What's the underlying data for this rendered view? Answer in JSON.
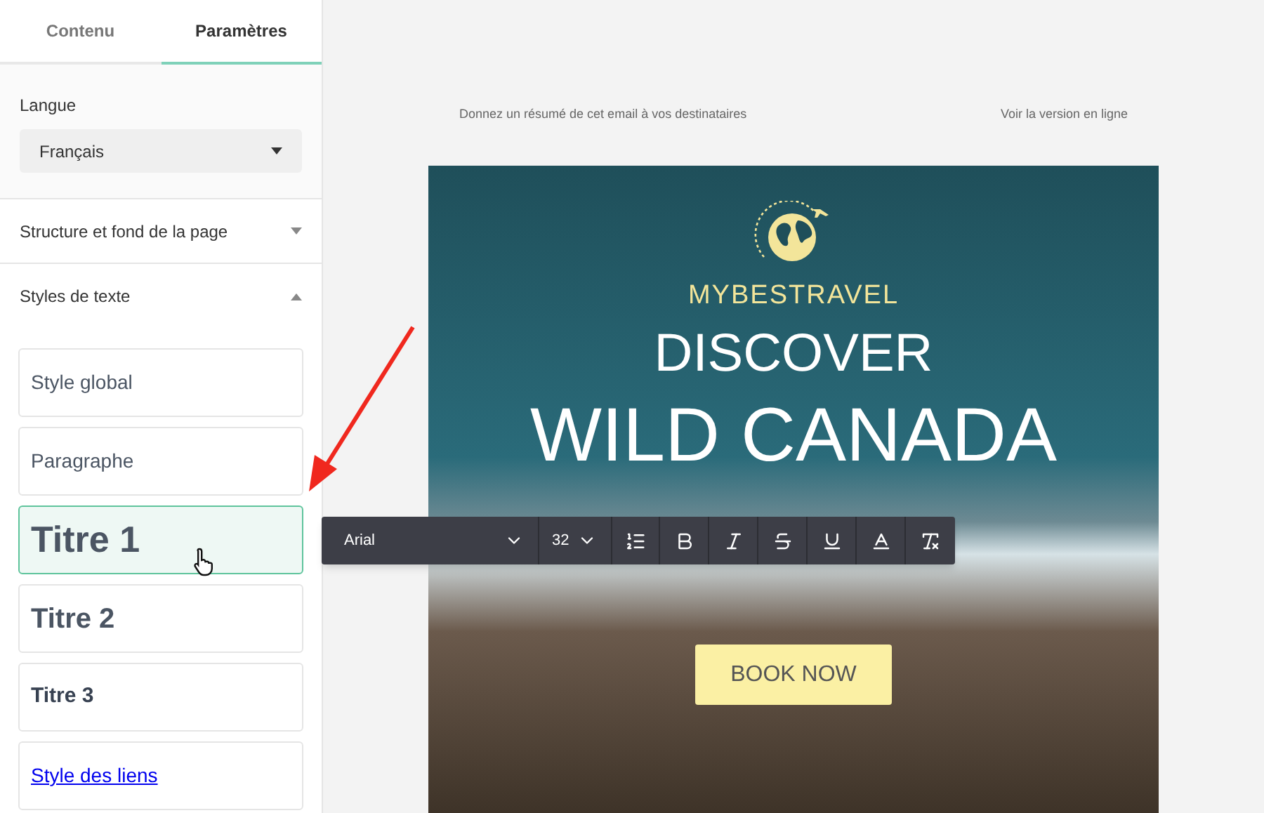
{
  "tabs": [
    {
      "label": "Contenu",
      "selected": false
    },
    {
      "label": "Paramètres",
      "selected": true
    }
  ],
  "language": {
    "label": "Langue",
    "value": "Français"
  },
  "sections": [
    {
      "title": "Structure et fond de la page",
      "expanded": false
    },
    {
      "title": "Styles de texte",
      "expanded": true
    }
  ],
  "text_styles": [
    {
      "label": "Style global",
      "kind": "global",
      "selected": false
    },
    {
      "label": "Paragraphe",
      "kind": "paragraph",
      "selected": false
    },
    {
      "label": "Titre 1",
      "kind": "h1",
      "selected": true
    },
    {
      "label": "Titre 2",
      "kind": "h2",
      "selected": false
    },
    {
      "label": "Titre 3",
      "kind": "h3",
      "selected": false
    },
    {
      "label": "Style des liens",
      "kind": "link",
      "selected": false
    }
  ],
  "preheader": {
    "summary": "Donnez un résumé de cet email à vos destinataires",
    "online_link": "Voir la version en ligne"
  },
  "email": {
    "brand": "MYBESTRAVEL",
    "headline_1": "DISCOVER",
    "headline_2": "WILD CANADA",
    "cta": "BOOK NOW"
  },
  "toolbar": {
    "font": "Arial",
    "size": "32"
  }
}
